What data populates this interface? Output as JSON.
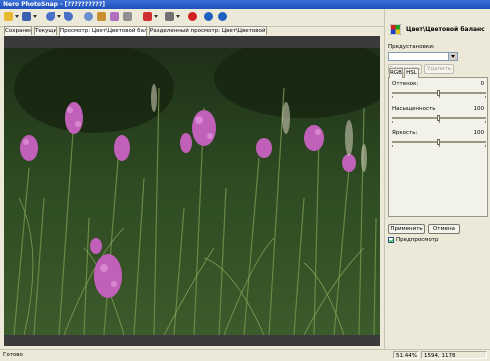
{
  "window": {
    "title": "Nero PhotoSnap - [??????????]"
  },
  "toolbar": {
    "buttons": [
      {
        "icon": "open-folder-icon",
        "color": "#e8b830"
      },
      {
        "icon": "save-icon",
        "color": "#3a5fb0"
      },
      {
        "icon": "undo-icon",
        "color": "#4a6fc8"
      },
      {
        "icon": "redo-icon",
        "color": "#4a6fc8"
      },
      {
        "icon": "zoom-icon",
        "color": "#6a8fd0"
      },
      {
        "icon": "crop-icon",
        "color": "#c89030"
      },
      {
        "icon": "magic-wand-icon",
        "color": "#b070c0"
      },
      {
        "icon": "brush-icon",
        "color": "#909090"
      },
      {
        "icon": "red-eye-icon",
        "color": "#d03030"
      },
      {
        "icon": "print-icon",
        "color": "#707070"
      },
      {
        "icon": "stop-icon",
        "color": "#d02020"
      },
      {
        "icon": "help-icon",
        "color": "#2060c0"
      },
      {
        "icon": "web-icon",
        "color": "#2060c0"
      }
    ]
  },
  "tabs": [
    {
      "label": "Сохранено"
    },
    {
      "label": "Текущий"
    },
    {
      "label": "Просмотр: Цвет\\Цветовой баланс"
    },
    {
      "label": "Разделенный просмотр: Цвет\\Цветовой баланс"
    }
  ],
  "panel": {
    "title": "Цвет\\Цветовой баланс",
    "presets_label": "Предустановки:",
    "preset_value": "",
    "save_label": "Сохранить",
    "delete_label": "Удалить",
    "subtabs": [
      {
        "label": "RGB"
      },
      {
        "label": "HSL"
      }
    ],
    "sliders": [
      {
        "label": "Оттенок:",
        "value": "0",
        "level": 0.5
      },
      {
        "label": "Насыщенность",
        "value": "100",
        "level": 0.5
      },
      {
        "label": "Яркость:",
        "value": "100",
        "level": 0.5
      }
    ],
    "apply_label": "Применить",
    "cancel_label": "Отмена",
    "preview_label": "Предпросмотр",
    "preview_checked": true
  },
  "status": {
    "text": "Готово",
    "zoom": "51.44%",
    "coords": "1594, 1178"
  },
  "colors": {
    "titlebar": "#2456c8",
    "magenta_flowers": "#c060b8"
  }
}
